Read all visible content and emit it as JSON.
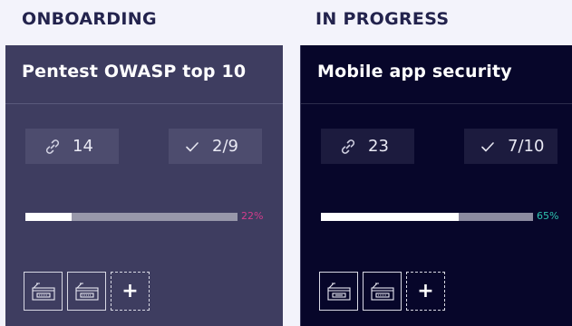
{
  "columns": [
    {
      "title": "ONBOARDING",
      "card": {
        "name": "Pentest OWASP top 10",
        "links_count": "14",
        "tasks": "2/9",
        "progress_percent": 22,
        "progress_label": "22%",
        "progress_color": "#d43c8c",
        "links_icon": "link-icon",
        "tasks_icon": "check-icon",
        "tool_icons": [
          "tool-card-icon",
          "tool-card-icon"
        ],
        "add_label": "+"
      }
    },
    {
      "title": "IN PROGRESS",
      "card": {
        "name": "Mobile app security",
        "links_count": "23",
        "tasks": "7/10",
        "progress_percent": 65,
        "progress_label": "65%",
        "progress_color": "#2ec4b0",
        "links_icon": "link-icon",
        "tasks_icon": "check-icon",
        "tool_icons": [
          "tool-card-icon",
          "tool-card-icon"
        ],
        "add_label": "+"
      }
    }
  ]
}
